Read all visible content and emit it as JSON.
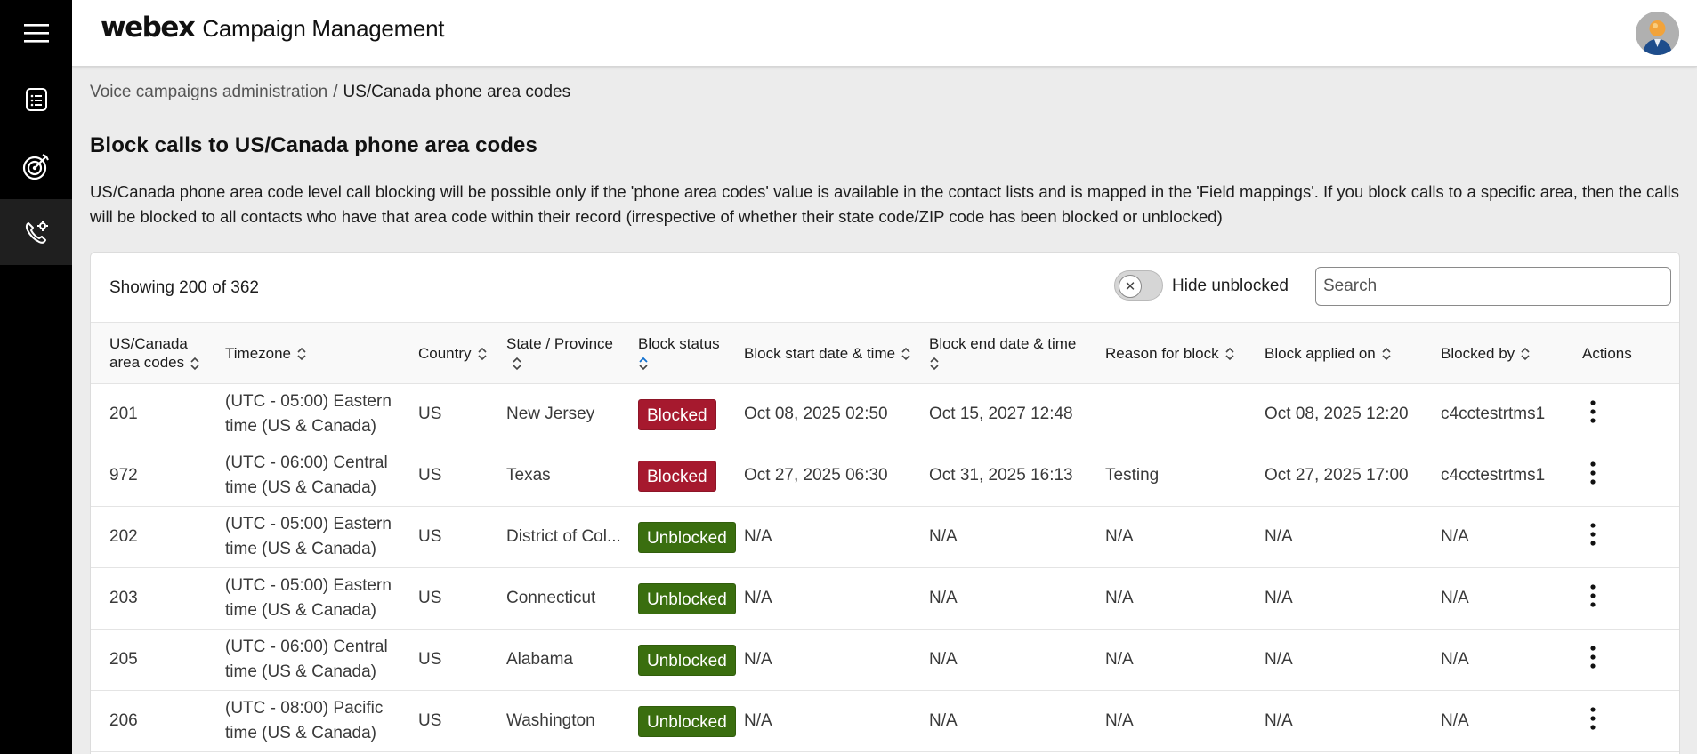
{
  "app": {
    "brand_logo": "webex",
    "brand_title": "Campaign Management"
  },
  "nav": {
    "items": [
      {
        "icon": "hamburger-menu-icon"
      },
      {
        "icon": "list-document-icon"
      },
      {
        "icon": "target-icon"
      },
      {
        "icon": "phone-settings-icon",
        "active": true
      }
    ]
  },
  "breadcrumb": {
    "parent": "Voice campaigns administration",
    "separator": "/",
    "current": "US/Canada phone area codes"
  },
  "page": {
    "title": "Block calls to US/Canada phone area codes",
    "description": "US/Canada phone area code level call blocking will be possible only if the 'phone area codes' value is available in the contact lists and is mapped in the 'Field mappings'. If you block calls to a specific area, then the calls will be blocked to all contacts who have that area code within their record (irrespective of whether their state code/ZIP code has been blocked or unblocked)"
  },
  "toolbar": {
    "showing": "Showing 200 of 362",
    "toggle_label": "Hide unblocked",
    "toggle_on": false,
    "search_placeholder": "Search"
  },
  "table": {
    "columns": [
      "US/Canada area codes",
      "Timezone",
      "Country",
      "State / Province",
      "Block status",
      "Block start date & time",
      "Block end date & time",
      "Reason for block",
      "Block applied on",
      "Blocked by",
      "Actions"
    ],
    "rows": [
      {
        "code": "201",
        "timezone": "(UTC - 05:00) Eastern time (US & Canada)",
        "country": "US",
        "state": "New Jersey",
        "status": "Blocked",
        "start": "Oct 08, 2025 02:50",
        "end": "Oct 15, 2027 12:48",
        "reason": "",
        "applied": "Oct 08, 2025 12:20",
        "by": "c4cctestrtms1"
      },
      {
        "code": "972",
        "timezone": "(UTC - 06:00) Central time (US & Canada)",
        "country": "US",
        "state": "Texas",
        "status": "Blocked",
        "start": "Oct 27, 2025 06:30",
        "end": "Oct 31, 2025 16:13",
        "reason": "Testing",
        "applied": "Oct 27, 2025 17:00",
        "by": "c4cctestrtms1"
      },
      {
        "code": "202",
        "timezone": "(UTC - 05:00) Eastern time (US & Canada)",
        "country": "US",
        "state": "District of Col...",
        "status": "Unblocked",
        "start": "N/A",
        "end": "N/A",
        "reason": "N/A",
        "applied": "N/A",
        "by": "N/A"
      },
      {
        "code": "203",
        "timezone": "(UTC - 05:00) Eastern time (US & Canada)",
        "country": "US",
        "state": "Connecticut",
        "status": "Unblocked",
        "start": "N/A",
        "end": "N/A",
        "reason": "N/A",
        "applied": "N/A",
        "by": "N/A"
      },
      {
        "code": "205",
        "timezone": "(UTC - 06:00) Central time (US & Canada)",
        "country": "US",
        "state": "Alabama",
        "status": "Unblocked",
        "start": "N/A",
        "end": "N/A",
        "reason": "N/A",
        "applied": "N/A",
        "by": "N/A"
      },
      {
        "code": "206",
        "timezone": "(UTC - 08:00) Pacific time (US & Canada)",
        "country": "US",
        "state": "Washington",
        "status": "Unblocked",
        "start": "N/A",
        "end": "N/A",
        "reason": "N/A",
        "applied": "N/A",
        "by": "N/A"
      }
    ]
  },
  "colors": {
    "blocked": "#a6192e",
    "unblocked": "#3a6e0f",
    "rail": "#000000",
    "sort_active": "#1170cf"
  }
}
